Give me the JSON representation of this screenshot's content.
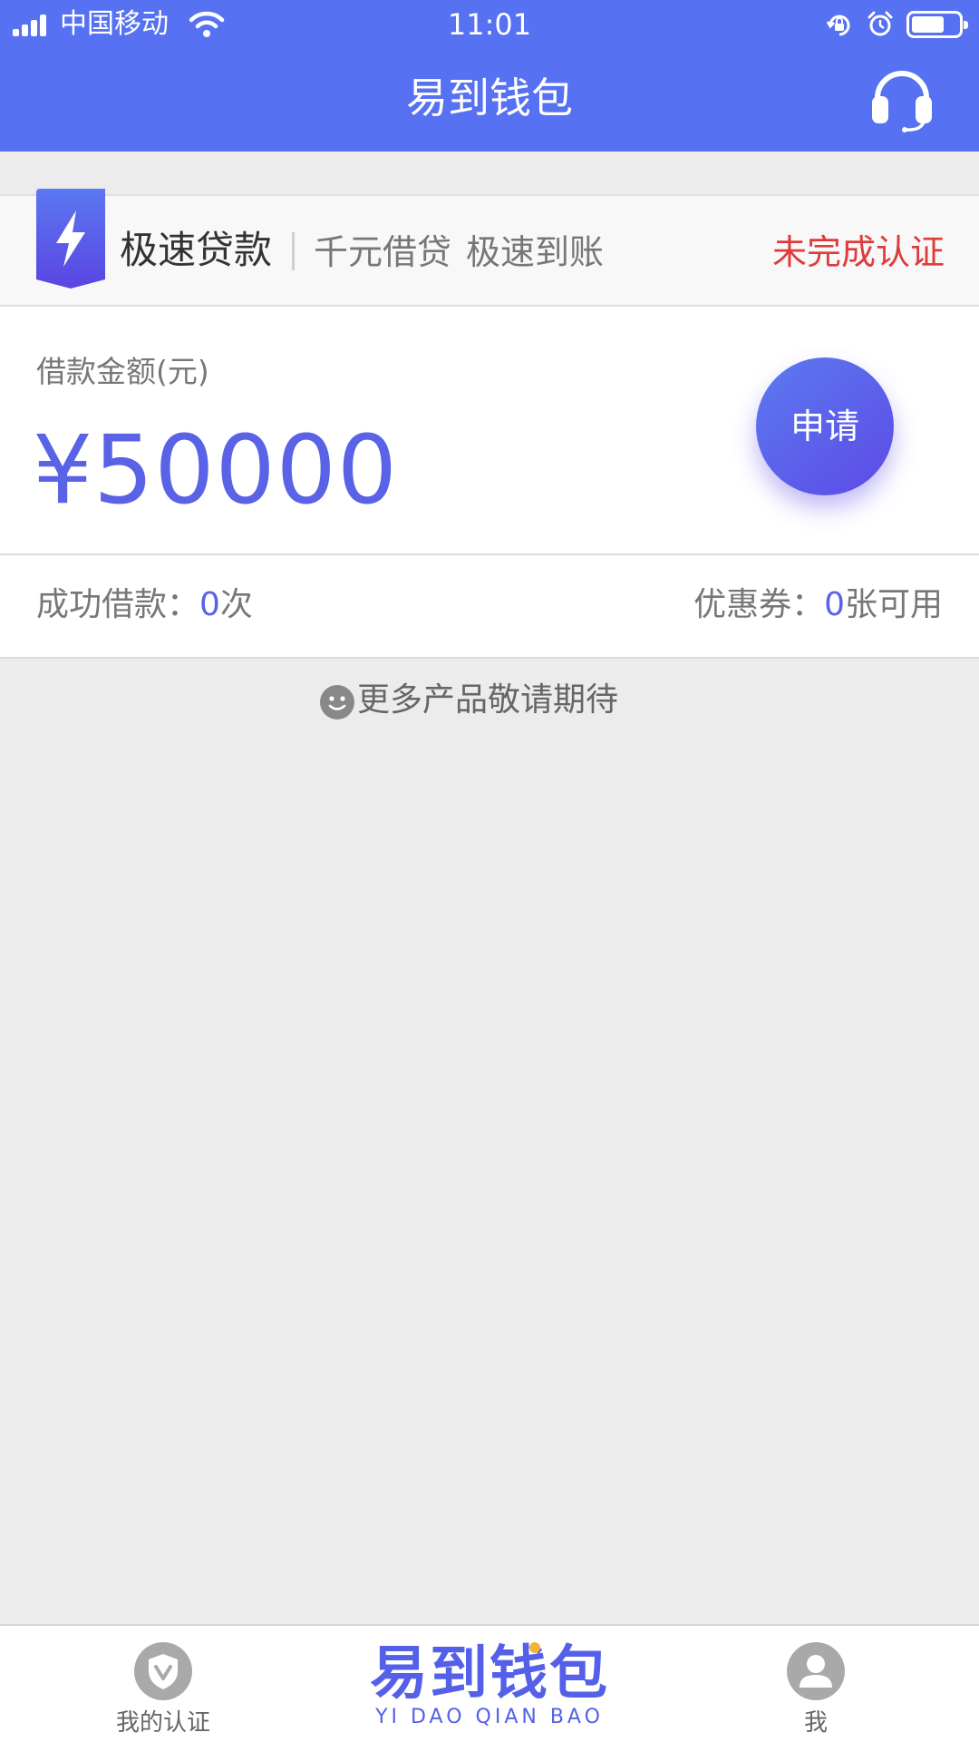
{
  "status_bar": {
    "carrier": "中国移动",
    "time": "11:01",
    "battery_level": 0.7
  },
  "header": {
    "title": "易到钱包",
    "icons": [
      "headset-icon"
    ]
  },
  "banner": {
    "title": "极速贷款",
    "tags": [
      "千元借贷",
      "极速到账"
    ],
    "status": "未完成认证",
    "icon": "lightning-ribbon-icon"
  },
  "loan": {
    "amount_label": "借款金额(元)",
    "amount": "¥50000",
    "apply_label": "申请"
  },
  "stats": {
    "success_label": "成功借款：",
    "success_count": "0",
    "success_unit": "次",
    "coupon_label": "优惠券：",
    "coupon_count": "0",
    "coupon_unit": "张可用"
  },
  "more": {
    "text": "更多产品敬请期待",
    "icon": "smiley-icon"
  },
  "tabbar": {
    "left_label": "我的认证",
    "left_icon": "shield-v-icon",
    "logo_cn": "易到钱包",
    "logo_en": "YI DAO QIAN BAO",
    "right_label": "我",
    "right_icon": "user-icon"
  },
  "colors": {
    "primary": "#5671f1",
    "amount": "#5a62e6",
    "alert": "#e03b3b",
    "background": "#ececec"
  }
}
